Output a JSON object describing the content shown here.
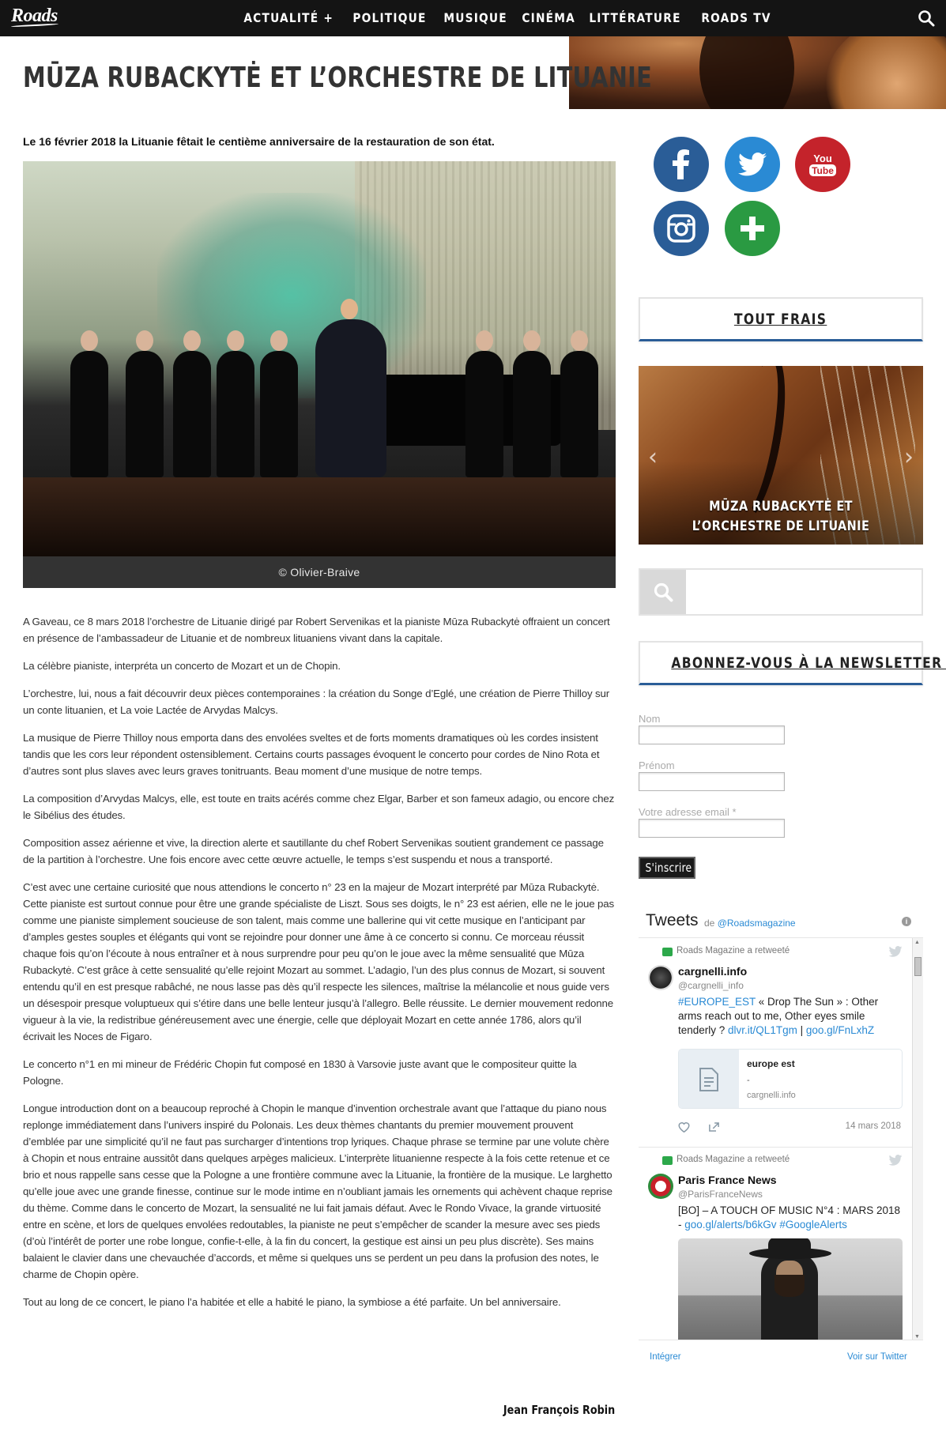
{
  "nav": {
    "logo": "Roads",
    "items": [
      "ACTUALITÉ +",
      "POLITIQUE",
      "MUSIQUE",
      "CINÉMA",
      "LITTÉRATURE",
      "ROADS TV"
    ]
  },
  "article": {
    "title": "MŪZA RUBACKYTĖ ET L’ORCHESTRE DE LITUANIE",
    "lead": "Le 16 février 2018 la Lituanie fêtait le centième anniversaire de la restauration de son état.",
    "photo_caption": "© Olivier-Braive",
    "paragraphs": [
      "A Gaveau, ce 8 mars 2018 l’orchestre de Lituanie dirigé par Robert Servenikas et la pianiste Mūza Rubackytė of­fraient un concert en présence de l’ambassadeur de Lituanie et de nombreux lituaniens vivant dans la capitale.",
      "La célèbre pianiste, interpréta un concerto de Mozart et un de Chopin.",
      "L’orchestre, lui, nous a fait découvrir deux pièces contemporaines : la création du Songe d’Eglé, une création de Pierre Thilloy sur un conte lituanien, et La voie Lactée de Arvydas Malcys.",
      "La musique de Pierre Thilloy nous emporta dans des envolées sveltes et de forts moments dramatiques où les cordes insistent tandis que les cors leur répondent ostensiblement. Certains courts passages évoquent le concerto pour cordes de Nino Rota et d’autres sont plus slaves avec leurs graves tonitruants. Beau moment d’une musique de notre temps.",
      "La composition d’Arvydas Malcys, elle, est toute en traits acérés comme chez Elgar, Barber et son fameux adagio, ou encore chez le Sibélius des études.",
      "Composition assez aérienne et vive, la direction alerte et sautillante du chef Robert Servenikas soutient grandement ce passage de la partition à l’orchestre. Une fois encore avec cette œuvre actuelle, le temps s’est suspendu et nous a transporté.",
      "C’est avec une certaine curiosité que nous attendions le concerto n° 23 en la majeur de Mozart interprété par Mūza Rubackytė. Cette pianiste est surtout connue pour être une grande spécialiste de Liszt. Sous ses doigts, le n° 23 est aérien, elle ne le joue pas comme une pianiste simplement soucieuse de son talent, mais comme une ballerine qui vit cette musique en l’anticipant par d’amples gestes souples et élégants qui vont se rejoindre pour donner une âme à ce concerto si connu. Ce morceau réussit chaque fois qu’on l’écoute à nous entraîner et à nous surprendre pour peu qu’on le joue avec la même sensualité que Mūza Rubackytė. C’est grâce à cette sensualité qu’elle rejoint Mozart au sommet. L’adagio, l’un des plus connus de Mozart, si souvent entendu qu’il en est presque rabâché, ne nous lasse pas dès qu’il respecte les silences, maîtrise la mélancolie et nous guide vers un désespoir presque voluptueux qui s’étire dans une belle lenteur jusqu’à l’allegro. Belle réussite.  Le dernier mouvement redonne vigueur à la vie, la redistribue généreusement avec une énergie, celle que déployait Mozart en cette année 1786, alors qu’il écrivait les Noces de Figaro.",
      "Le concerto n°1 en mi mineur de Frédéric Chopin fut composé en 1830 à  Varsovie juste avant que le compositeur quitte la Pologne.",
      "Longue introduction dont on a beaucoup reproché à Chopin le manque d’invention orchestrale avant que l’attaque du piano nous replonge immédiatement dans l’univers inspiré du Polonais. Les deux thèmes chantants du premier mouvement prouvent d’emblée par une simplicité qu’il ne faut pas surcharger d’intentions trop lyriques. Chaque phrase se termine par une volute chère à Chopin et nous entraine aussitôt dans quelques arpèges malicieux. L’inter­prète lituanienne respecte à la fois cette retenue et ce brio et nous rappelle sans cesse que la Pologne a une fron­tière commune avec la Lituanie, la frontière de la musique. Le larghetto qu’elle joue avec une grande finesse, conti­nue sur le mode intime en n’oubliant jamais les ornements qui achèvent chaque reprise du thème. Comme dans le concerto de Mozart, la sensualité ne lui fait jamais défaut. Avec le Rondo Vivace, la grande virtuosité entre en scène, et lors de quelques envolées redoutables, la pianiste ne peut s’empêcher de scander la mesure avec ses pieds (d’où l’intérêt de porter une robe longue, confie-t-elle, à la fin du concert, la gestique est ainsi un peu plus discrète). Ses mains balaient le clavier dans une chevauchée d’accords, et même si quelques uns se perdent un peu dans la profusion des notes, le charme de Chopin opère.",
      "Tout au long de ce  concert, le piano l’a habitée et elle a habité le piano, la symbiose a été  parfaite. Un bel anniver­saire."
    ],
    "author": "Jean François Robin"
  },
  "sidebar": {
    "social_icons": [
      "facebook-icon",
      "twitter-icon",
      "youtube-icon",
      "instagram-icon",
      "plus-icon"
    ],
    "youtube_text": [
      "You",
      "Tube"
    ],
    "tout_frais_title": "TOUT FRAIS",
    "slider_title": "MŪZA RUBACKYTĖ ET L’ORCHESTRE DE LITUANIE",
    "newsletter_title": "ABONNEZ-VOUS À LA NEWSLETTER !",
    "newsletter": {
      "name_label": "Nom",
      "firstname_label": "Prénom",
      "email_label": "Votre adresse email *",
      "submit": "S'inscrire"
    }
  },
  "twitter": {
    "title": "Tweets",
    "by_prefix": "de",
    "by_handle": "@Roadsmagazine",
    "tweets": [
      {
        "retweet_line": "Roads Magazine a retweeté",
        "name": "cargnelli.info",
        "handle": "@cargnelli_info",
        "text_1": "#EUROPE_EST",
        "text_2": " « Drop The Sun » : Other arms reach out to me, Other eyes smile tenderly ? ",
        "text_3": "dlvr.it/QL1Tgm",
        "text_4": " | ",
        "text_5": "goo.gl/FnLxhZ",
        "card_title": "europe est",
        "card_dash": "-",
        "card_domain": "cargnelli.info",
        "date": "14 mars 2018"
      },
      {
        "retweet_line": "Roads Magazine a retweeté",
        "name": "Paris France News",
        "handle": "@ParisFranceNews",
        "text_1": "[BO] – A TOUCH OF MUSIC N°4 : MARS 2018 - ",
        "text_2": "goo.gl/alerts/b6kGv",
        "text_3": " ",
        "text_4": "#GoogleAlerts"
      }
    ],
    "embed": "Intégrer",
    "view_on": "Voir sur Twitter"
  },
  "colors": {
    "nav_bg": "#141414",
    "facebook": "#2a5d97",
    "twitter": "#2a8ad4",
    "youtube": "#c4232b",
    "plus": "#2a9a42",
    "accent_border": "#2a5d97"
  }
}
